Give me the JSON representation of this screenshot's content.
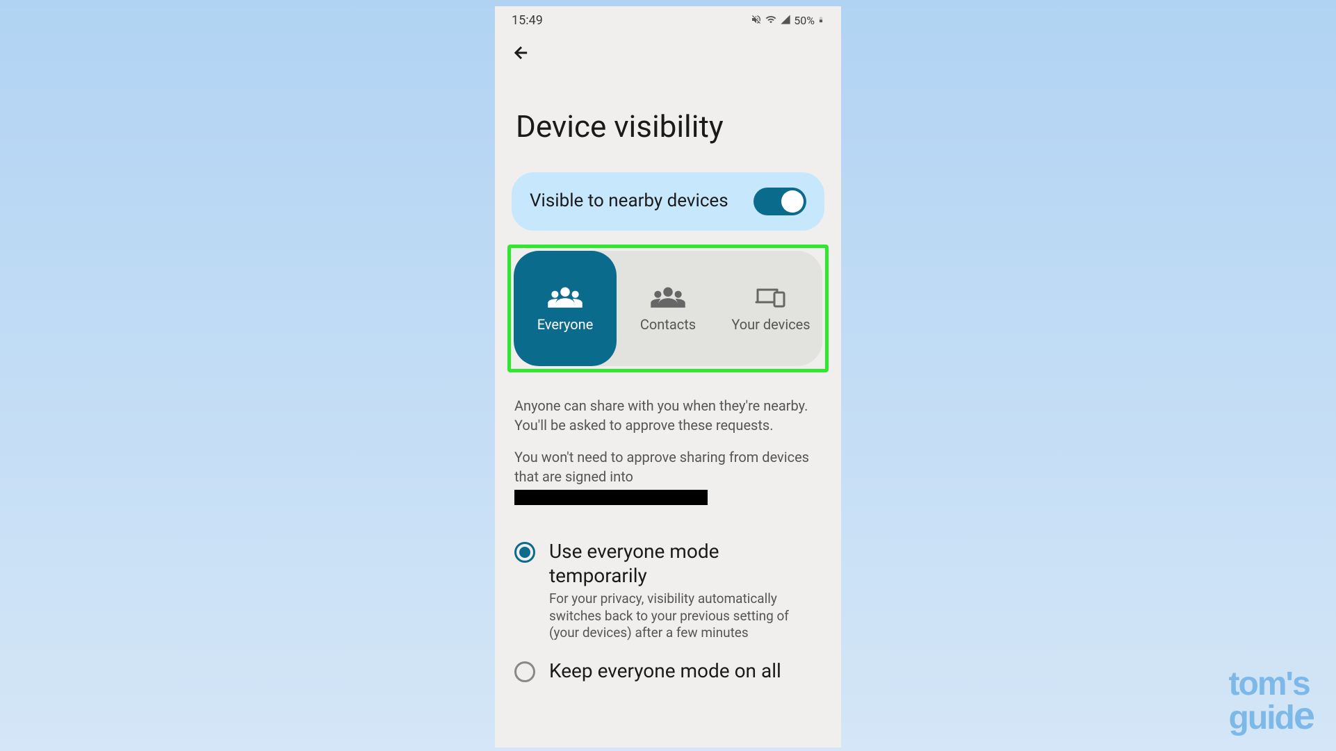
{
  "status_bar": {
    "time": "15:49",
    "battery": "50%"
  },
  "page": {
    "title": "Device visibility"
  },
  "toggle": {
    "label": "Visible to nearby devices",
    "enabled": true
  },
  "segments": {
    "items": [
      {
        "label": "Everyone",
        "icon": "groups-icon",
        "active": true
      },
      {
        "label": "Contacts",
        "icon": "groups-icon",
        "active": false
      },
      {
        "label": "Your devices",
        "icon": "devices-icon",
        "active": false
      }
    ]
  },
  "description": {
    "para1": "Anyone can share with you when they're nearby. You'll be asked to approve these requests.",
    "para2": "You won't need to approve sharing from devices that are signed into"
  },
  "radio_options": {
    "items": [
      {
        "title": "Use everyone mode temporarily",
        "description": "For your privacy, visibility automatically switches back to your previous setting of (your devices) after a few minutes",
        "selected": true
      },
      {
        "title": "Keep everyone mode on all",
        "description": "",
        "selected": false
      }
    ]
  },
  "watermark": {
    "line1": "tom's",
    "line2": "guide"
  }
}
